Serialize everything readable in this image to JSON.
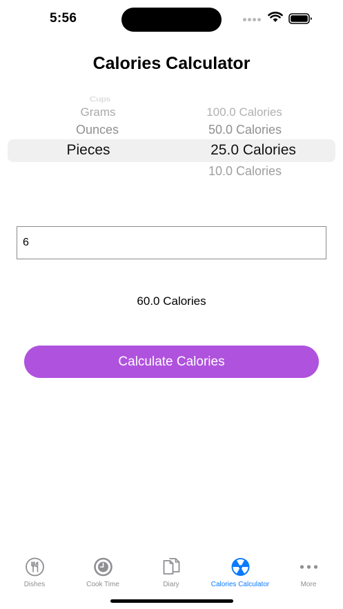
{
  "status": {
    "time": "5:56"
  },
  "title": "Calories Calculator",
  "picker": {
    "units": [
      "Cups",
      "Grams",
      "Ounces",
      "Pieces"
    ],
    "selected_unit": "Pieces",
    "calories": [
      "100.0 Calories",
      "50.0 Calories",
      "25.0 Calories",
      "10.0 Calories"
    ],
    "selected_calories": "25.0 Calories"
  },
  "quantity_input": {
    "value": "6"
  },
  "result": "60.0 Calories",
  "button": {
    "label": "Calculate Calories",
    "color": "#af52de"
  },
  "tabs": [
    {
      "label": "Dishes",
      "icon": "fork-knife-icon"
    },
    {
      "label": "Cook Time",
      "icon": "timer-icon"
    },
    {
      "label": "Diary",
      "icon": "documents-icon"
    },
    {
      "label": "Calories Calculator",
      "icon": "atom-icon",
      "active": true
    },
    {
      "label": "More",
      "icon": "more-icon"
    }
  ],
  "colors": {
    "accent": "#0a7aff",
    "inactive": "#8e8e93"
  }
}
